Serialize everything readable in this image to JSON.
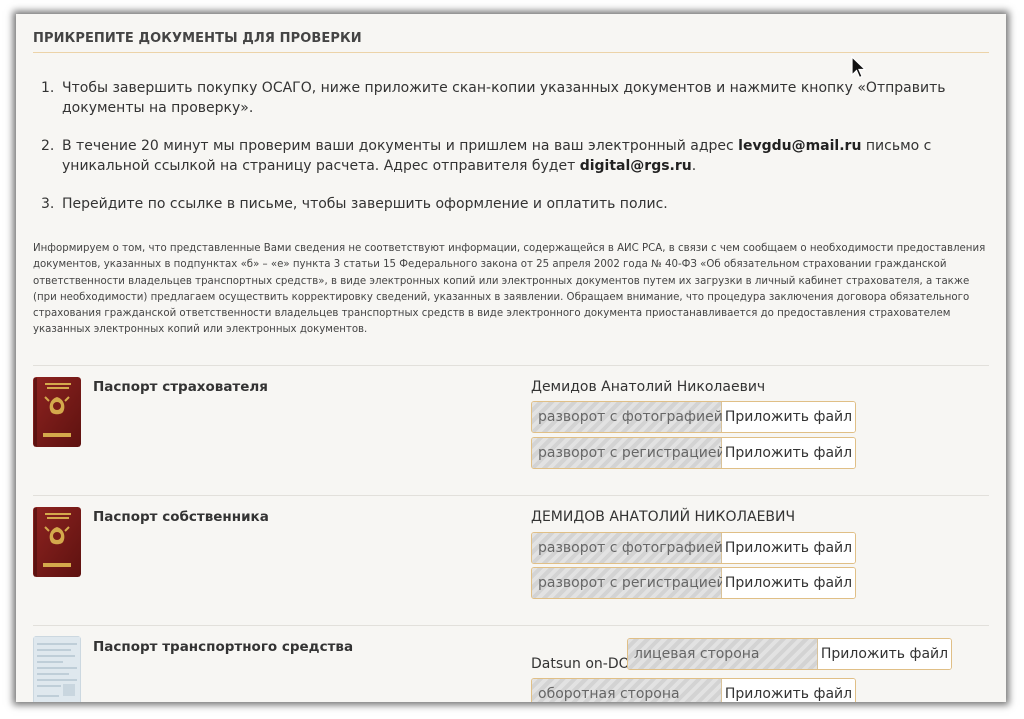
{
  "header": {
    "title": "ПРИКРЕПИТЕ ДОКУМЕНТЫ ДЛЯ ПРОВЕРКИ"
  },
  "steps": [
    {
      "num": "1.",
      "text": "Чтобы завершить покупку ОСАГО, ниже приложите скан-копии указанных документов и нажмите кнопку «Отправить документы на проверку»."
    },
    {
      "num": "2.",
      "text_before": "В течение 20 минут мы проверим ваши документы и пришлем на ваш электронный адрес ",
      "email": "levgdu@mail.ru",
      "text_middle": " письмо с уникальной ссылкой на страницу расчета. Адрес отправителя будет ",
      "sender": "digital@rgs.ru",
      "text_after": "."
    },
    {
      "num": "3.",
      "text": "Перейдите по ссылке в письме, чтобы завершить оформление и оплатить полис."
    }
  ],
  "notice": "Информируем о том, что представленные Вами сведения не соответствуют информации, содержащейся в АИС РСА, в связи с чем сообщаем о необходимости предоставления документов, указанных в подпунктах «б» – «е» пункта 3 статьи 15 Федерального закона от 25 апреля 2002 года № 40-ФЗ «Об обязательном страховании гражданской ответственности владельцев транспортных средств», в виде электронных копий или электронных документов путем их загрузки в личный кабинет страхователя, а также (при необходимости) предлагаем осуществить корректировку сведений, указанных в заявлении. Обращаем внимание, что процедура заключения договора обязательного страхования гражданской ответственности владельцев транспортных средств в виде электронного документа приостанавливается до предоставления страхователем указанных электронных копий или электронных документов.",
  "documents": [
    {
      "title": "Паспорт страхователя",
      "icon": "passport-icon",
      "owner": "Демидов Анатолий Николаевич",
      "fields": [
        {
          "label": "разворот с фотографией",
          "button": "Приложить файл"
        },
        {
          "label": "разворот с регистрацией",
          "button": "Приложить файл"
        }
      ]
    },
    {
      "title": "Паспорт собственника",
      "icon": "passport-icon",
      "owner": "ДЕМИДОВ АНАТОЛИЙ НИКОЛАЕВИЧ",
      "fields": [
        {
          "label": "разворот с фотографией",
          "button": "Приложить файл"
        },
        {
          "label": "разворот с регистрацией",
          "button": "Приложить файл"
        }
      ]
    },
    {
      "title": "Паспорт транспортного средства",
      "icon": "vehicle-passport-icon",
      "owner": "Datsun on-DO",
      "fields": [
        {
          "label": "лицевая сторона",
          "button": "Приложить файл"
        },
        {
          "label": "оборотная сторона",
          "button": "Приложить файл"
        }
      ]
    }
  ],
  "colors": {
    "accent_border": "#e0bf86",
    "background": "#f7f6f3",
    "passport": "#7a1a17"
  }
}
